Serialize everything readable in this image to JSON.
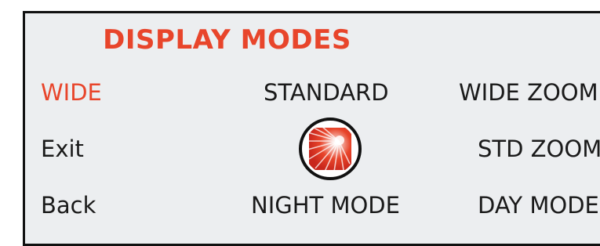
{
  "title": "DISPLAY MODES",
  "menu": {
    "wide": "WIDE",
    "standard": "STANDARD",
    "wide_zoom": "WIDE ZOOM",
    "exit": "Exit",
    "std_zoom": "STD ZOOM",
    "back": "Back",
    "night_mode": "NIGHT MODE",
    "day_mode": "DAY MODE"
  },
  "colors": {
    "accent": "#e8452b",
    "panel_bg": "#eceef0",
    "text": "#1a1a1a"
  },
  "selected": "wide",
  "dial_icon": "brightness-dial-icon"
}
